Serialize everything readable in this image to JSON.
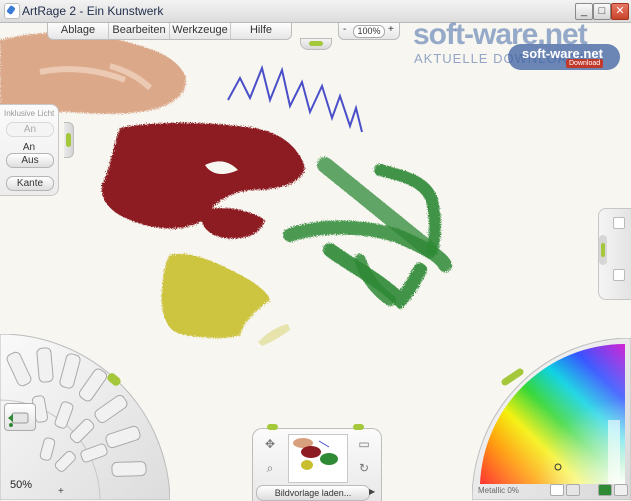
{
  "window": {
    "title": "ArtRage 2 - Ein Kunstwerk",
    "controls": {
      "minimize": "_",
      "maximize": "□",
      "close": "✕"
    }
  },
  "menu": {
    "items": [
      "Ablage",
      "Bearbeiten",
      "Werkzeuge",
      "Hilfe"
    ]
  },
  "zoom": {
    "minus": "-",
    "value": "100%",
    "plus": "+"
  },
  "watermark": {
    "main": "soft-ware.net",
    "sub": "AKTUELLE DOWNLOADS",
    "badge_main": "soft-ware.net",
    "badge_sub": "Download"
  },
  "tool_options": {
    "title": "Inklusive Licht",
    "on_dim": "An",
    "on": "An",
    "off": "Aus",
    "edge": "Kante"
  },
  "status": {
    "zoom_percent": "50%",
    "add": "+"
  },
  "tracing": {
    "label": "Bildvorlage laden...",
    "arrow": "▶"
  },
  "color_picker": {
    "label": "Metallic 0%"
  },
  "colors": {
    "accent_handle": "#a5c83a",
    "paint_peach": "#d9a07f",
    "paint_red": "#8c1c22",
    "paint_green": "#2f8a35",
    "paint_yellow": "#c9bf2e",
    "paint_blue": "#4a4fc9"
  }
}
